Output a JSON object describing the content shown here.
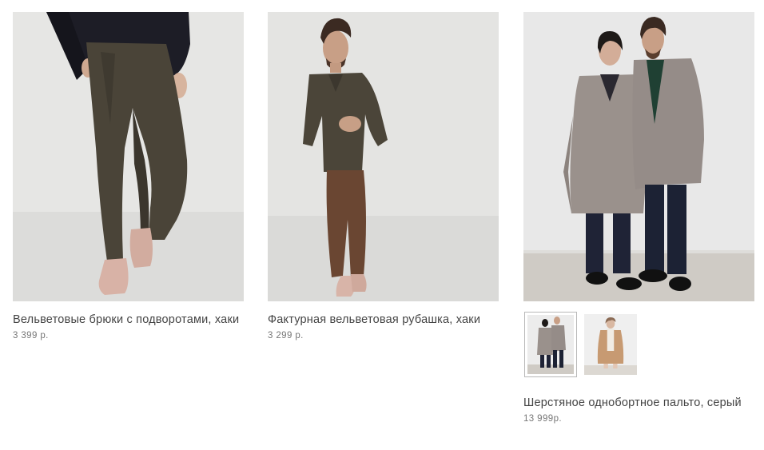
{
  "products": [
    {
      "title": "Вельветовые брюки с подворотами, хаки",
      "price": "3 399 р.",
      "image_alt": "Мужчина в вельветовых брюках цвета хаки"
    },
    {
      "title": "Фактурная вельветовая рубашка, хаки",
      "price": "3 299 р.",
      "image_alt": "Мужчина в вельветовой рубашке"
    },
    {
      "title": "Шерстяное однобортное пальто, серый",
      "price": "13 999р.",
      "image_alt": "Пара в серых шерстяных пальто"
    }
  ],
  "colors": {
    "background": "#ffffff",
    "text": "#444444",
    "price": "#777777",
    "khaki": "#4a4438",
    "grey_coat": "#9a918c",
    "camel_coat": "#c79a72"
  }
}
